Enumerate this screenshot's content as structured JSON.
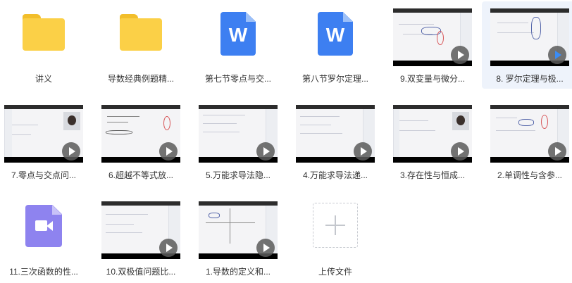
{
  "files": [
    {
      "label": "讲义"
    },
    {
      "label": "导数经典例题精..."
    },
    {
      "label": "第七节零点与交..."
    },
    {
      "label": "第八节罗尔定理..."
    },
    {
      "label": "9.双变量与微分..."
    },
    {
      "label": "8. 罗尔定理与极..."
    },
    {
      "label": "7.零点与交点问..."
    },
    {
      "label": "6.超越不等式放..."
    },
    {
      "label": "5.万能求导法隐..."
    },
    {
      "label": "4.万能求导法递..."
    },
    {
      "label": "3.存在性与恒成..."
    },
    {
      "label": "2.单调性与含参..."
    },
    {
      "label": "11.三次函数的性..."
    },
    {
      "label": "10.双极值问题比..."
    },
    {
      "label": "1.导数的定义和..."
    }
  ],
  "upload": {
    "label": "上传文件"
  },
  "icons": {
    "folder": "folder-icon",
    "word": "word-document-icon",
    "video": "video-file-icon",
    "play": "play-icon",
    "upload": "plus-icon"
  },
  "colors": {
    "folder": "#fbd047",
    "word": "#3d7ff1",
    "video_doc": "#8e83ef",
    "selected_bg": "#eef3fb"
  }
}
